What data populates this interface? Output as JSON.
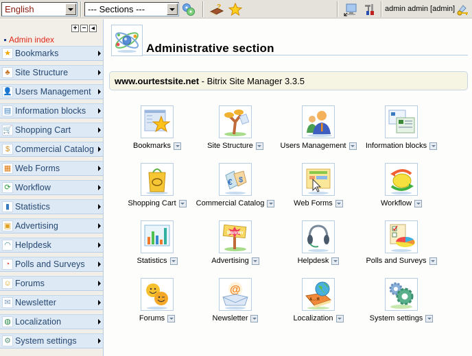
{
  "toolbar": {
    "language": "English",
    "sections": "--- Sections ---",
    "user": "admin admin [admin]",
    "icons": [
      "site-map-icon",
      "help-book-icon",
      "favorites-star-icon",
      "public-section-icon",
      "tools-icon",
      "logout-key-icon"
    ]
  },
  "sidebar": {
    "controls": {
      "expand": "+",
      "collapse": "−",
      "hide": "◂"
    },
    "admin_index": "Admin index",
    "items": [
      {
        "label": "Bookmarks",
        "icon": "bookmarks-icon",
        "glyph": "★",
        "color": "#f0a800"
      },
      {
        "label": "Site Structure",
        "icon": "site-structure-icon",
        "glyph": "♣",
        "color": "#c8762a"
      },
      {
        "label": "Users Management",
        "icon": "users-icon",
        "glyph": "👤",
        "color": "#e88a20"
      },
      {
        "label": "Information blocks",
        "icon": "info-blocks-icon",
        "glyph": "▤",
        "color": "#3a7fc0"
      },
      {
        "label": "Shopping Cart",
        "icon": "shopping-cart-icon",
        "glyph": "🛒",
        "color": "#3a8fd0"
      },
      {
        "label": "Commercial Catalog",
        "icon": "catalog-icon",
        "glyph": "$",
        "color": "#d0902a"
      },
      {
        "label": "Web Forms",
        "icon": "web-forms-icon",
        "glyph": "▦",
        "color": "#e07a10"
      },
      {
        "label": "Workflow",
        "icon": "workflow-icon",
        "glyph": "⟳",
        "color": "#2a9a3a"
      },
      {
        "label": "Statistics",
        "icon": "statistics-icon",
        "glyph": "▮",
        "color": "#3a7ac0"
      },
      {
        "label": "Advertising",
        "icon": "advertising-icon",
        "glyph": "▣",
        "color": "#e0a020"
      },
      {
        "label": "Helpdesk",
        "icon": "helpdesk-icon",
        "glyph": "◠",
        "color": "#4a8aa0"
      },
      {
        "label": "Polls and Surveys",
        "icon": "polls-icon",
        "glyph": "◔",
        "color": "#e04040"
      },
      {
        "label": "Forums",
        "icon": "forums-icon",
        "glyph": "☺",
        "color": "#e0a010"
      },
      {
        "label": "Newsletter",
        "icon": "newsletter-icon",
        "glyph": "✉",
        "color": "#7a9ac0"
      },
      {
        "label": "Localization",
        "icon": "localization-icon",
        "glyph": "◍",
        "color": "#2a8a4a"
      },
      {
        "label": "System settings",
        "icon": "system-settings-icon",
        "glyph": "⚙",
        "color": "#5a9a7a"
      }
    ]
  },
  "main": {
    "title": "Administrative section",
    "site": "www.ourtestsite.net",
    "product": " - Bitrix Site Manager 3.3.5",
    "tiles": [
      {
        "label": "Bookmarks",
        "icon": "bookmarks-icon"
      },
      {
        "label": "Site Structure",
        "icon": "site-structure-icon"
      },
      {
        "label": "Users Management",
        "icon": "users-icon"
      },
      {
        "label": "Information blocks",
        "icon": "info-blocks-icon"
      },
      {
        "label": "Shopping Cart",
        "icon": "shopping-cart-icon"
      },
      {
        "label": "Commercial Catalog",
        "icon": "catalog-icon"
      },
      {
        "label": "Web Forms",
        "icon": "web-forms-icon"
      },
      {
        "label": "Workflow",
        "icon": "workflow-icon"
      },
      {
        "label": "Statistics",
        "icon": "statistics-icon"
      },
      {
        "label": "Advertising",
        "icon": "advertising-icon"
      },
      {
        "label": "Helpdesk",
        "icon": "helpdesk-icon"
      },
      {
        "label": "Polls and Surveys",
        "icon": "polls-icon"
      },
      {
        "label": "Forums",
        "icon": "forums-icon"
      },
      {
        "label": "Newsletter",
        "icon": "newsletter-icon"
      },
      {
        "label": "Localization",
        "icon": "localization-icon"
      },
      {
        "label": "System settings",
        "icon": "system-settings-icon"
      }
    ]
  }
}
